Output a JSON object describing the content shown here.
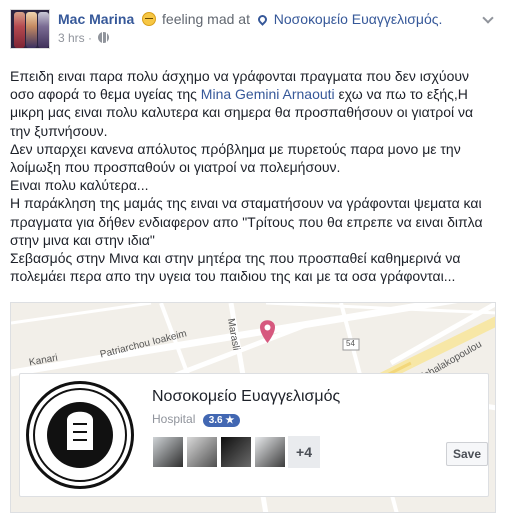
{
  "post": {
    "author": "Mac Marina",
    "feeling": "feeling mad at",
    "place": "Νοσοκομείο Ευαγγελισμός.",
    "time": "3 hrs",
    "dot": "·",
    "text": {
      "l1": "Επειδη ειναι παρα πολυ άσχημο να γράφονται πραγματα που δεν ισχύουν",
      "l2a": "οσο αφορά το θεμα υγείας της ",
      "l2m": "Mina Gemini Arnaouti",
      "l2b": " εχω να πω το εξής,Η",
      "l3": "μικρη μας ειναι πολυ καλυτερα και σημερα θα προσπαθήσουν οι γιατροί να",
      "l4": "την ξυπνήσουν.",
      "l5": "Δεν υπαρχει κανενα απόλυτος πρόβλημα με πυρετούς παρα μονο με την",
      "l6": "λοίμωξη που προσπαθούν οι γιατροί να πολεμήσουν.",
      "l7": "Ειναι πολυ καλύτερα...",
      "l8": "Η παράκληση της μαμάς της ειναι να σταματήσουν να γράφονται ψεματα και",
      "l9": "πραγματα για δήθεν ενδιαφερον απο \"Τρίτους που θα επρεπε να ειναι διπλα",
      "l10": "στην μινα και στην ιδια\"",
      "l11": "Σεβασμός στην Μινα και στην μητέρα της που προσπαθεί καθημερινά να",
      "l12": "πολεμάει περα απο την υγεια του παιδιου της και με τα οσα γράφονται..."
    }
  },
  "map": {
    "streets": {
      "patriarchou": "Patriarchou Ioakeim",
      "marasli": "Marasli",
      "kanari": "Kanari",
      "michalakopoulou": "Michalakopoulou",
      "route": "54"
    }
  },
  "place_card": {
    "name": "Νοσοκομείο Ευαγγελισμός",
    "category": "Hospital",
    "rating": "3.6 ★",
    "more_visitors": "+4",
    "save_label": "Save"
  },
  "colors": {
    "link": "#365899",
    "rating_badge": "#4267b2",
    "map_pin": "#d6587e"
  },
  "icons": {
    "feeling": "angry-face-icon",
    "location": "map-pin-icon",
    "audience": "globe-icon",
    "menu": "chevron-down-icon"
  }
}
